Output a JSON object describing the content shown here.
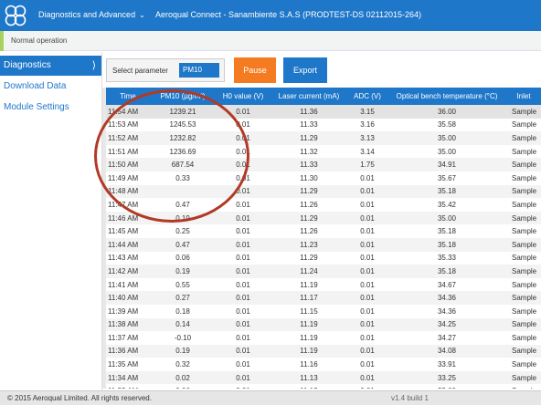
{
  "header": {
    "menu_label": "Diagnostics and Advanced",
    "device_label": "Aeroqual Connect - Sanambiente S.A.S (PRODTEST-DS 02112015-264)"
  },
  "status": {
    "text": "Normal operation"
  },
  "sidebar": {
    "items": [
      {
        "label": "Diagnostics"
      },
      {
        "label": "Download Data"
      },
      {
        "label": "Module Settings"
      }
    ]
  },
  "toolbar": {
    "select_label": "Select parameter",
    "select_value": "PM10",
    "pause_label": "Pause",
    "export_label": "Export"
  },
  "table": {
    "headers": [
      "Time",
      "PM10 (µg/m³)",
      "H0 value (V)",
      "Laser current (mA)",
      "ADC (V)",
      "Optical bench temperature (°C)",
      "Inlet"
    ],
    "rows": [
      [
        "11:54 AM",
        "1239.21",
        "0.01",
        "11.36",
        "3.15",
        "36.00",
        "Sample"
      ],
      [
        "11:53 AM",
        "1245.53",
        "0.01",
        "11.33",
        "3.16",
        "35.58",
        "Sample"
      ],
      [
        "11:52 AM",
        "1232.82",
        "0.01",
        "11.29",
        "3.13",
        "35.00",
        "Sample"
      ],
      [
        "11:51 AM",
        "1236.69",
        "0.01",
        "11.32",
        "3.14",
        "35.00",
        "Sample"
      ],
      [
        "11:50 AM",
        "687.54",
        "0.01",
        "11.33",
        "1.75",
        "34.91",
        "Sample"
      ],
      [
        "11:49 AM",
        "0.33",
        "0.01",
        "11.30",
        "0.01",
        "35.67",
        "Sample"
      ],
      [
        "11:48 AM",
        "",
        "0.01",
        "11.29",
        "0.01",
        "35.18",
        "Sample"
      ],
      [
        "11:47 AM",
        "0.47",
        "0.01",
        "11.26",
        "0.01",
        "35.42",
        "Sample"
      ],
      [
        "11:46 AM",
        "0.19",
        "0.01",
        "11.29",
        "0.01",
        "35.00",
        "Sample"
      ],
      [
        "11:45 AM",
        "0.25",
        "0.01",
        "11.26",
        "0.01",
        "35.18",
        "Sample"
      ],
      [
        "11:44 AM",
        "0.47",
        "0.01",
        "11.23",
        "0.01",
        "35.18",
        "Sample"
      ],
      [
        "11:43 AM",
        "0.06",
        "0.01",
        "11.29",
        "0.01",
        "35.33",
        "Sample"
      ],
      [
        "11:42 AM",
        "0.19",
        "0.01",
        "11.24",
        "0.01",
        "35.18",
        "Sample"
      ],
      [
        "11:41 AM",
        "0.55",
        "0.01",
        "11.19",
        "0.01",
        "34.67",
        "Sample"
      ],
      [
        "11:40 AM",
        "0.27",
        "0.01",
        "11.17",
        "0.01",
        "34.36",
        "Sample"
      ],
      [
        "11:39 AM",
        "0.18",
        "0.01",
        "11.15",
        "0.01",
        "34.36",
        "Sample"
      ],
      [
        "11:38 AM",
        "0.14",
        "0.01",
        "11.19",
        "0.01",
        "34.25",
        "Sample"
      ],
      [
        "11:37 AM",
        "-0.10",
        "0.01",
        "11.19",
        "0.01",
        "34.27",
        "Sample"
      ],
      [
        "11:36 AM",
        "0.19",
        "0.01",
        "11.19",
        "0.01",
        "34.08",
        "Sample"
      ],
      [
        "11:35 AM",
        "0.32",
        "0.01",
        "11.16",
        "0.01",
        "33.91",
        "Sample"
      ],
      [
        "11:34 AM",
        "0.02",
        "0.01",
        "11.13",
        "0.01",
        "33.25",
        "Sample"
      ],
      [
        "11:33 AM",
        "0.06",
        "0.01",
        "11.13",
        "0.01",
        "33.00",
        "Sample"
      ]
    ]
  },
  "footer": {
    "copyright": "© 2015 Aeroqual Limited. All rights reserved.",
    "version": "v1.4 build 1"
  },
  "colors": {
    "brand_blue": "#1f77c9",
    "pause_orange": "#f47b20",
    "status_green": "#a8d160",
    "annotation_red": "#b13a26"
  },
  "icons": {
    "logo": "aeroqual-logo-icon",
    "menu_chevron": "chevron-down-icon",
    "sidebar_arrow": "chevron-right-icon"
  }
}
